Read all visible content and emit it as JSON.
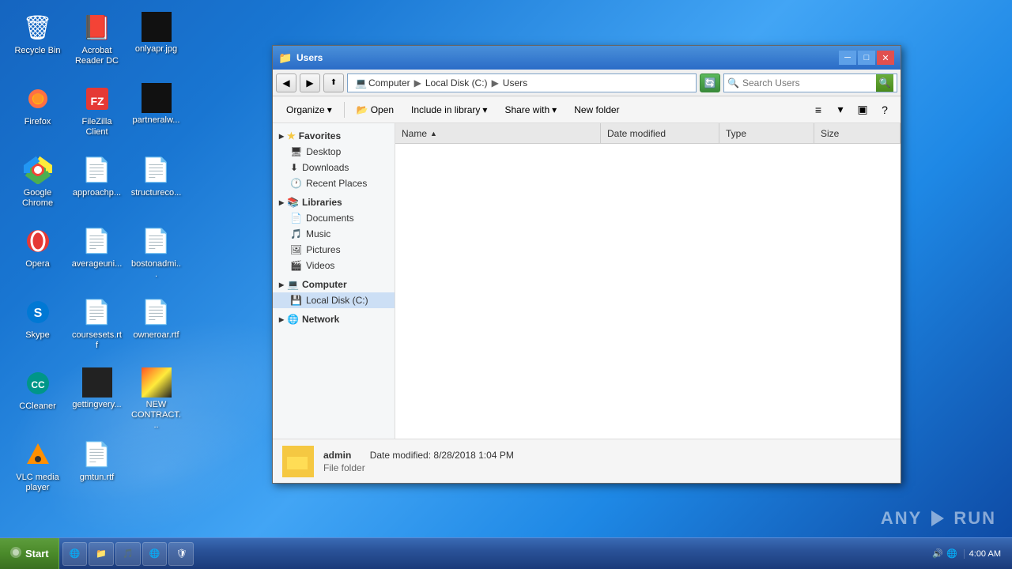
{
  "window": {
    "title": "Users",
    "title_icon": "📁"
  },
  "addressbar": {
    "path": [
      "Computer",
      "Local Disk (C:)",
      "Users"
    ],
    "search_placeholder": "Search Users"
  },
  "toolbar": {
    "organize": "Organize",
    "open": "Open",
    "include_library": "Include in library",
    "share_with": "Share with",
    "new_folder": "New folder",
    "help": "?"
  },
  "nav": {
    "favorites_label": "Favorites",
    "favorites_items": [
      {
        "label": "Desktop",
        "icon": "🖥"
      },
      {
        "label": "Downloads",
        "icon": "⬇"
      },
      {
        "label": "Recent Places",
        "icon": "🕐"
      }
    ],
    "libraries_label": "Libraries",
    "libraries_items": [
      {
        "label": "Documents",
        "icon": "📄"
      },
      {
        "label": "Music",
        "icon": "🎵"
      },
      {
        "label": "Pictures",
        "icon": "🖼"
      },
      {
        "label": "Videos",
        "icon": "🎬"
      }
    ],
    "computer_label": "Computer",
    "computer_items": [
      {
        "label": "Local Disk (C:)",
        "icon": "💾",
        "selected": true
      }
    ],
    "network_label": "Network"
  },
  "columns": {
    "name": "Name",
    "date_modified": "Date modified",
    "type": "Type",
    "size": "Size"
  },
  "status": {
    "name": "admin",
    "date_label": "Date modified:",
    "date_value": "8/28/2018 1:04 PM",
    "type": "File folder"
  },
  "desktop_icons": [
    {
      "label": "Recycle Bin",
      "icon": "🗑",
      "col": 1,
      "row": 1
    },
    {
      "label": "Acrobat Reader DC",
      "icon": "📕",
      "col": 2,
      "row": 1
    },
    {
      "label": "onlyapr.jpg",
      "icon": "🖼",
      "col": 3,
      "row": 1
    },
    {
      "label": "Firefox",
      "icon": "🦊",
      "col": 1,
      "row": 2
    },
    {
      "label": "FileZilla Client",
      "icon": "📁",
      "col": 2,
      "row": 2
    },
    {
      "label": "partneralw...",
      "icon": "📄",
      "col": 3,
      "row": 2
    },
    {
      "label": "Google Chrome",
      "icon": "🔵",
      "col": 1,
      "row": 3
    },
    {
      "label": "approachp...",
      "icon": "📄",
      "col": 2,
      "row": 3
    },
    {
      "label": "structureco...",
      "icon": "📄",
      "col": 3,
      "row": 3
    },
    {
      "label": "Opera",
      "icon": "🔴",
      "col": 1,
      "row": 4
    },
    {
      "label": "averageuni...",
      "icon": "📄",
      "col": 2,
      "row": 4
    },
    {
      "label": "bostonadmi...",
      "icon": "📄",
      "col": 3,
      "row": 4
    },
    {
      "label": "Skype",
      "icon": "💬",
      "col": 1,
      "row": 5
    },
    {
      "label": "coursesets.rtf",
      "icon": "📄",
      "col": 2,
      "row": 5
    },
    {
      "label": "owneroar.rtf",
      "icon": "📄",
      "col": 3,
      "row": 5
    },
    {
      "label": "CCleaner",
      "icon": "🧹",
      "col": 1,
      "row": 6
    },
    {
      "label": "gettingvery...",
      "icon": "⬛",
      "col": 2,
      "row": 6
    },
    {
      "label": "NEW CONTRACT...",
      "icon": "🖼",
      "col": 3,
      "row": 6
    },
    {
      "label": "VLC media player",
      "icon": "🎬",
      "col": 1,
      "row": 7
    },
    {
      "label": "gmtun.rtf",
      "icon": "📄",
      "col": 2,
      "row": 7
    }
  ],
  "taskbar": {
    "start_label": "Start",
    "time": "4:00 AM",
    "items": [
      "🌐",
      "📁",
      "🎵",
      "🌐",
      "🛡"
    ]
  },
  "anyrun": {
    "logo": "ANY▶RUN"
  }
}
